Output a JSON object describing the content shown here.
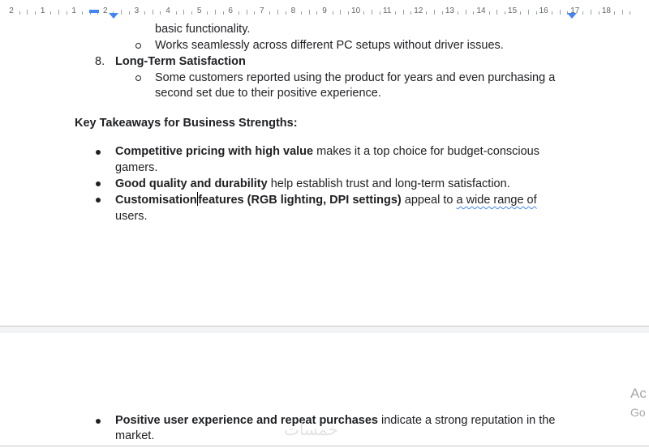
{
  "ruler": {
    "numbers": [
      "2",
      "1",
      "1",
      "2",
      "3",
      "4",
      "5",
      "6",
      "7",
      "8",
      "9",
      "10",
      "11",
      "12",
      "13",
      "14",
      "15",
      "16",
      "17",
      "18"
    ]
  },
  "document": {
    "lines": {
      "l1": "basic functionality.",
      "l2": "Works seamlessly across different PC setups without driver issues.",
      "item8_number": "8.",
      "item8_title": "Long-Term Satisfaction",
      "l4a": "Some customers reported using the product for years and even purchasing a",
      "l4b": "second set due to their positive experience.",
      "heading": "Key Takeaways for Business Strengths:",
      "b1_bold": "Competitive pricing with high value",
      "b1_rest": " makes it a top choice for budget-conscious",
      "b1_cont": "gamers.",
      "b2_bold": "Good quality and durability",
      "b2_rest": " help establish trust and long-term satisfaction.",
      "b3_bold_a": "Customisation",
      "b3_bold_b": "features (RGB lighting, DPI settings)",
      "b3_rest_a": " appeal to ",
      "b3_spell": "a wide range of",
      "b3_cont": "users.",
      "p2_bold": "Positive user experience and repeat purchases",
      "p2_rest": " indicate a strong reputation in the",
      "p2_cont": "market."
    }
  },
  "overlay": {
    "activate_1": "Ac",
    "activate_2": "Go",
    "watermark": "خمسات"
  },
  "colors": {
    "text": "#202124",
    "accent": "#4285f4"
  }
}
